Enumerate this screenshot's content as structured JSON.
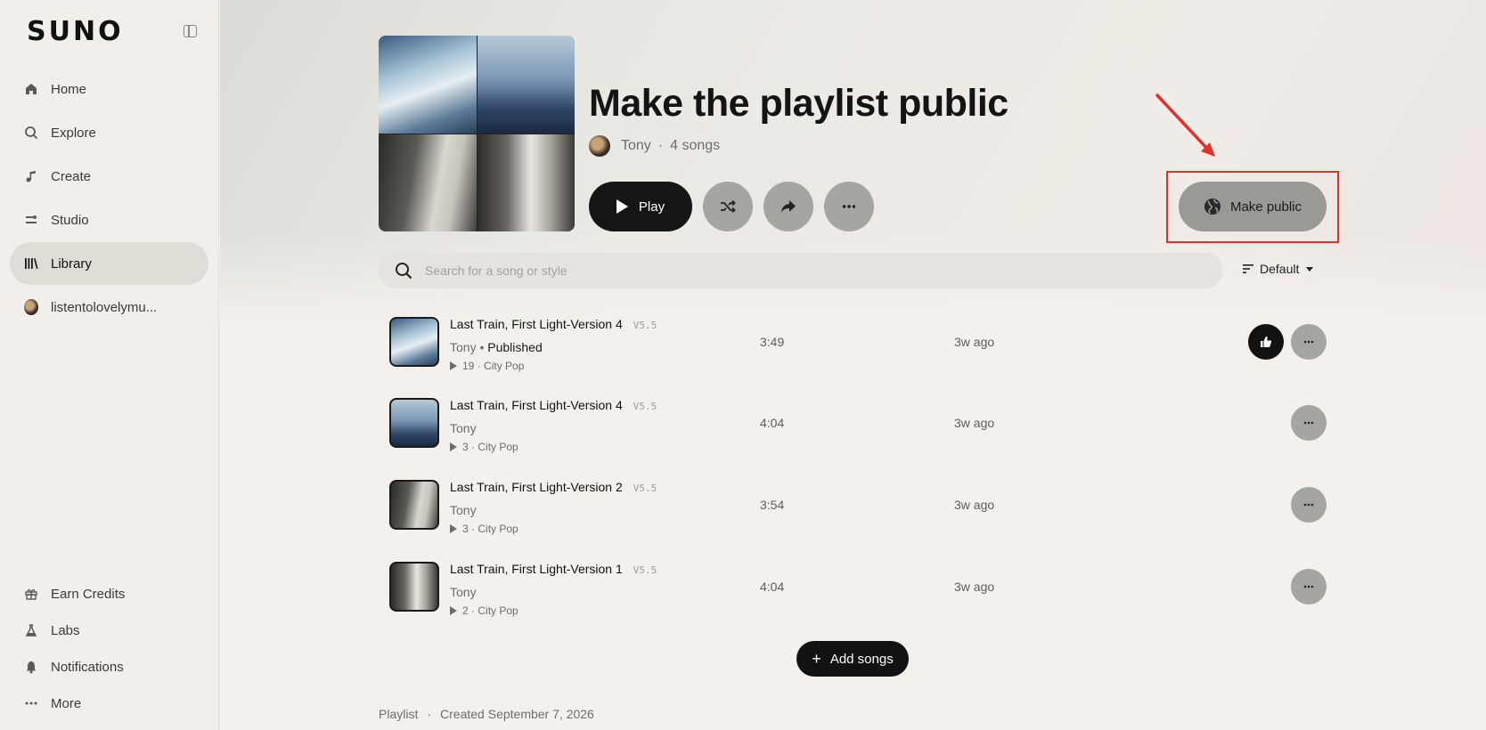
{
  "sidebar": {
    "logo": "SUNO",
    "nav": [
      {
        "label": "Home",
        "icon": "home-icon"
      },
      {
        "label": "Explore",
        "icon": "search-icon"
      },
      {
        "label": "Create",
        "icon": "music-note-icon"
      },
      {
        "label": "Studio",
        "icon": "studio-icon"
      },
      {
        "label": "Library",
        "icon": "library-icon",
        "active": true
      },
      {
        "label": "listentolovelymu...",
        "icon": "avatar"
      }
    ],
    "bottom": [
      {
        "label": "Earn Credits",
        "icon": "gift-icon"
      },
      {
        "label": "Labs",
        "icon": "flask-icon"
      },
      {
        "label": "Notifications",
        "icon": "bell-icon"
      },
      {
        "label": "More",
        "icon": "more-dots-icon"
      }
    ]
  },
  "playlist": {
    "title": "Make the playlist public",
    "owner": "Tony",
    "dot": "·",
    "song_count": "4 songs",
    "play_label": "Play",
    "make_public_label": "Make public",
    "search_placeholder": "Search for a song or style",
    "sort_label": "Default",
    "add_songs_label": "Add songs",
    "footer_type": "Playlist",
    "footer_sep": "·",
    "footer_created": "Created September 7, 2026"
  },
  "songs": [
    {
      "title": "Last Train, First Light-Version 4",
      "version": "V5.5",
      "artist": "Tony",
      "published": "Published",
      "plays": "19",
      "genre": "City Pop",
      "duration": "3:49",
      "age": "3w ago",
      "liked": true
    },
    {
      "title": "Last Train, First Light-Version 4",
      "version": "V5.5",
      "artist": "Tony",
      "published": "",
      "plays": "3",
      "genre": "City Pop",
      "duration": "4:04",
      "age": "3w ago",
      "liked": false
    },
    {
      "title": "Last Train, First Light-Version 2",
      "version": "V5.5",
      "artist": "Tony",
      "published": "",
      "plays": "3",
      "genre": "City Pop",
      "duration": "3:54",
      "age": "3w ago",
      "liked": false
    },
    {
      "title": "Last Train, First Light-Version 1",
      "version": "V5.5",
      "artist": "Tony",
      "published": "",
      "plays": "2",
      "genre": "City Pop",
      "duration": "4:04",
      "age": "3w ago",
      "liked": false
    }
  ],
  "colors": {
    "accent": "#121212",
    "annotation": "#e0312f"
  }
}
